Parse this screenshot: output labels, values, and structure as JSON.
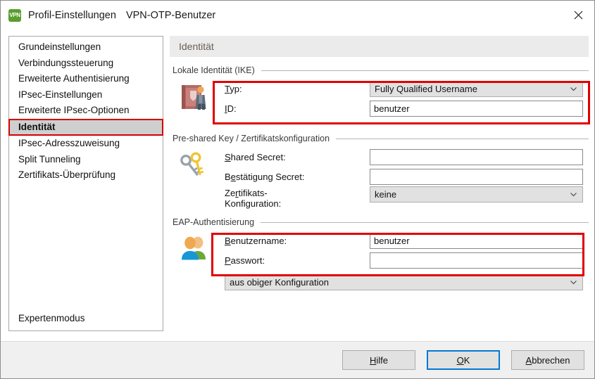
{
  "window": {
    "app_icon_label": "VPN",
    "title": "Profil-Einstellungen",
    "subtitle": "VPN-OTP-Benutzer",
    "close_label": "✕"
  },
  "sidebar": {
    "items": [
      {
        "label": "Grundeinstellungen",
        "selected": false
      },
      {
        "label": "Verbindungssteuerung",
        "selected": false
      },
      {
        "label": "Erweiterte Authentisierung",
        "selected": false
      },
      {
        "label": "IPsec-Einstellungen",
        "selected": false
      },
      {
        "label": "Erweiterte IPsec-Optionen",
        "selected": false
      },
      {
        "label": "Identität",
        "selected": true
      },
      {
        "label": "IPsec-Adresszuweisung",
        "selected": false
      },
      {
        "label": "Split Tunneling",
        "selected": false
      },
      {
        "label": "Zertifikats-Überprüfung",
        "selected": false
      }
    ],
    "expert_mode": "Expertenmodus"
  },
  "main": {
    "header": "Identität",
    "groups": {
      "local_identity": {
        "title": "Lokale Identität (IKE)",
        "icon": "passport-id-icon",
        "type_label_pre": "T",
        "type_label_post": "yp:",
        "type_value": "Fully Qualified Username",
        "id_label_pre": "I",
        "id_label_post": "D:",
        "id_value": "benutzer",
        "highlighted": true
      },
      "preshared_key": {
        "title": "Pre-shared Key / Zertifikatskonfiguration",
        "icon": "keys-icon",
        "shared_secret_label_pre": "S",
        "shared_secret_label_post": "hared Secret:",
        "shared_secret_value": "",
        "confirm_secret_label_a": "B",
        "confirm_secret_label_u": "e",
        "confirm_secret_label_b": "stätigung Secret:",
        "confirm_secret_value": "",
        "cert_config_label_a": "Ze",
        "cert_config_label_u": "r",
        "cert_config_label_b": "tifikats-",
        "cert_config_label_line2": "Konfiguration:",
        "cert_config_value": "keine",
        "highlighted": false
      },
      "eap_auth": {
        "title": "EAP-Authentisierung",
        "icon": "users-icon",
        "username_label_pre": "B",
        "username_label_post": "enutzername:",
        "username_value": "benutzer",
        "password_label_pre": "P",
        "password_label_post": "asswort:",
        "password_value": "",
        "source_value": "aus obiger Konfiguration",
        "highlighted": true
      }
    }
  },
  "footer": {
    "help_pre": "H",
    "help_post": "ilfe",
    "ok_pre": "O",
    "ok_post": "K",
    "cancel_pre": "A",
    "cancel_post": "bbrechen"
  },
  "colors": {
    "highlight_red": "#e00000",
    "accent_blue": "#0078d7",
    "app_green": "#5a9e2f",
    "selection_gray": "#cfcfcf"
  }
}
